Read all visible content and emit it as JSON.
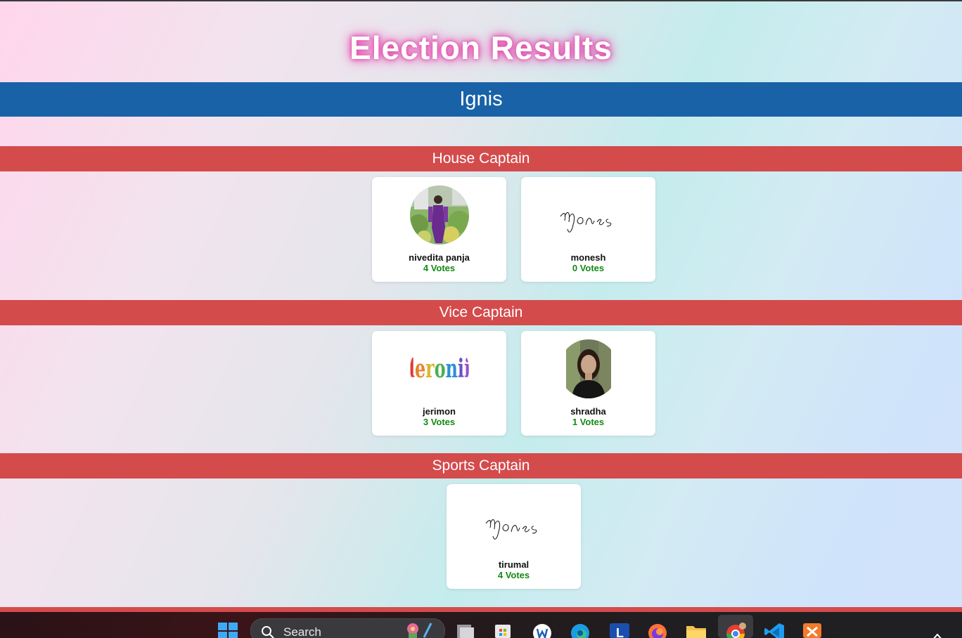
{
  "page": {
    "title": "Election Results",
    "house": "Ignis"
  },
  "sections": [
    {
      "title": "House Captain",
      "candidates": [
        {
          "name": "nivedita panja",
          "votes": "4 Votes",
          "avatar": "photo-avatar"
        },
        {
          "name": "monesh",
          "votes": "0 Votes",
          "avatar": "signature-avatar"
        }
      ]
    },
    {
      "title": "Vice Captain",
      "candidates": [
        {
          "name": "jerimon",
          "votes": "3 Votes",
          "avatar": "rainbow-text-avatar"
        },
        {
          "name": "shradha",
          "votes": "1 Votes",
          "avatar": "photo-avatar"
        }
      ]
    },
    {
      "title": "Sports Captain",
      "candidates": [
        {
          "name": "tirumal",
          "votes": "4 Votes",
          "avatar": "signature-avatar"
        }
      ]
    }
  ],
  "taskbar": {
    "search_label": "Search",
    "icons": [
      "windows-start-icon",
      "search-icon",
      "task-view-icon",
      "store-icon",
      "word-icon",
      "edge-icon",
      "l-app-icon",
      "firefox-icon",
      "file-explorer-icon",
      "chrome-icon",
      "vscode-icon",
      "xampp-icon",
      "chevron-up-icon"
    ]
  },
  "colors": {
    "house_banner": "#1962a7",
    "section_header": "#d44b4c",
    "votes": "#138a13",
    "title_glow": "#e040a8"
  }
}
